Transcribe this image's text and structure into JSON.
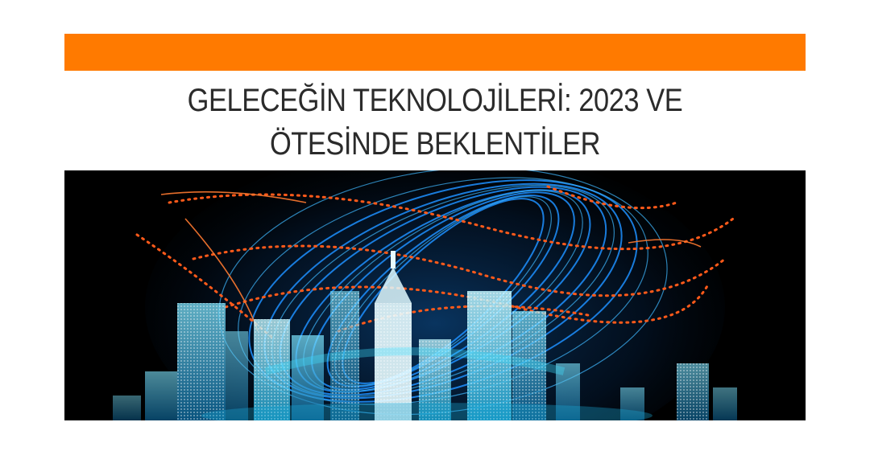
{
  "header": {
    "accent_color": "#ff7a00",
    "title": "GELECEĞİN TEKNOLOJİLERİ: 2023 VE ÖTESİNDE BEKLENTİLER"
  },
  "hero_image": {
    "icon": "futuristic-digital-city-illustration",
    "colors": {
      "background": "#000000",
      "blue_glow": "#1e90ff",
      "cyan": "#3fe0ff",
      "orange_glow": "#ff5a1a"
    }
  }
}
